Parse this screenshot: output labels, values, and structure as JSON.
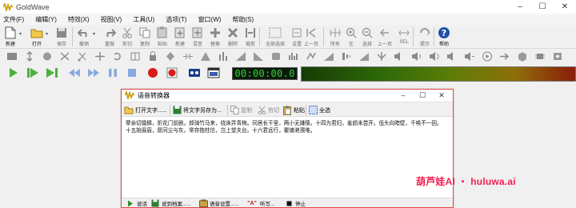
{
  "window": {
    "title": "GoldWave",
    "controls": [
      "–",
      "☐",
      "✕"
    ]
  },
  "menu": [
    "文件(F)",
    "编辑(Y)",
    "特效(X)",
    "视图(V)",
    "工具(U)",
    "选项(T)",
    "窗口(W)",
    "帮助(S)"
  ],
  "toolbar": {
    "new": "新建",
    "open": "打开",
    "save": "保存",
    "undo": "撤销",
    "redo": "重做",
    "cut": "剪切",
    "copy": "复制",
    "paste": "粘贴",
    "paste_new": "新建",
    "mix": "混音",
    "replace": "替换",
    "delete": "删除",
    "trim": "裁剪",
    "select_all": "全部选择",
    "set_selection": "设置",
    "prev": "上一页",
    "all": "所有",
    "zoom_in": "在",
    "zoom_out": "选择",
    "prev2": "上一页",
    "sel": "SEL",
    "cue": "提示",
    "help": "帮助"
  },
  "transport": {
    "timecode": "00:00:00.0"
  },
  "dialog": {
    "title": "语音转换器",
    "controls": [
      "–",
      "☐",
      "✕"
    ],
    "toolbar": {
      "open_text": "打开文字......",
      "save_text_as": "将文字另存为...",
      "copy": "复制",
      "cut": "剪切",
      "paste": "粘贴",
      "select_all": "全选"
    },
    "body_text": "孽亲切擂鳞，折花门前剧。郎骑竹马来，绕床弄青梅。同居长干里，两小无嫌猜。十四为君妇，羞颜未尝开。低头向暗壁，千唤不一回。十五始展眉，愿同尘与灰。常存抱柱信，岂上望夫台。十六君远行，瞿塘滟滪堆。",
    "bottom": {
      "speak": "说话",
      "save_to_file": "说到档案......",
      "voice_settings": "语音设置......",
      "dictate": "听写...",
      "stop": "停止"
    }
  },
  "watermark": "葫芦娃AI ・ huluwa.ai",
  "colors": {
    "timecode_green": "#35d135",
    "dialog_border": "#e04a4a",
    "watermark": "#f02050"
  }
}
